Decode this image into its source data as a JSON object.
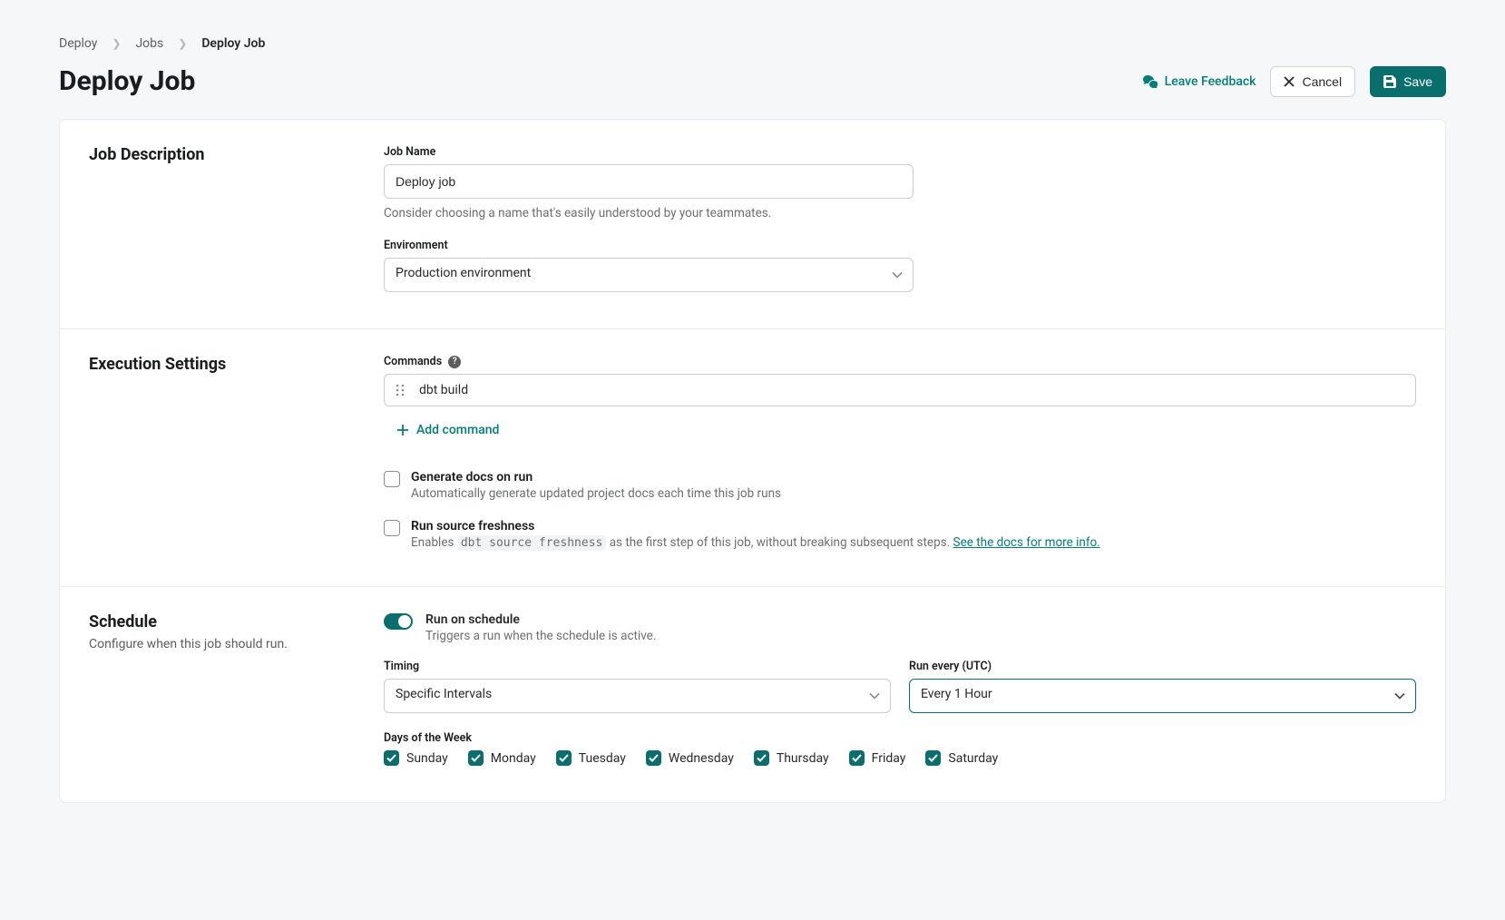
{
  "breadcrumb": [
    "Deploy",
    "Jobs",
    "Deploy Job"
  ],
  "page_title": "Deploy Job",
  "header": {
    "feedback": "Leave Feedback",
    "cancel": "Cancel",
    "save": "Save"
  },
  "job_description": {
    "heading": "Job Description",
    "name_label": "Job Name",
    "name_value": "Deploy job",
    "name_helper": "Consider choosing a name that's easily understood by your teammates.",
    "env_label": "Environment",
    "env_value": "Production environment"
  },
  "execution": {
    "heading": "Execution Settings",
    "commands_label": "Commands",
    "command_value": "dbt build",
    "add_command": "Add command",
    "gen_docs_title": "Generate docs on run",
    "gen_docs_desc": "Automatically generate updated project docs each time this job runs",
    "source_freshness_title": "Run source freshness",
    "source_freshness_prefix": "Enables ",
    "source_freshness_code": "dbt source freshness",
    "source_freshness_suffix": " as the first step of this job, without breaking subsequent steps. ",
    "source_freshness_link": "See the docs for more info."
  },
  "schedule": {
    "heading": "Schedule",
    "subtitle": "Configure when this job should run.",
    "toggle_title": "Run on schedule",
    "toggle_desc": "Triggers a run when the schedule is active.",
    "timing_label": "Timing",
    "timing_value": "Specific Intervals",
    "run_every_label": "Run every (UTC)",
    "run_every_value": "Every 1 Hour",
    "days_label": "Days of the Week",
    "days": [
      "Sunday",
      "Monday",
      "Tuesday",
      "Wednesday",
      "Thursday",
      "Friday",
      "Saturday"
    ]
  }
}
